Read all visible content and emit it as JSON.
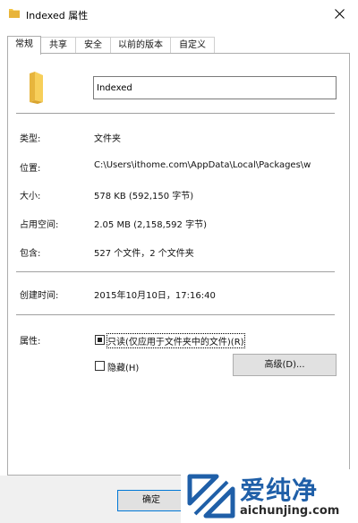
{
  "window": {
    "title": "Indexed 属性",
    "close_icon": "close-icon",
    "folder_icon_color": "#f4c542"
  },
  "tabs": [
    {
      "label": "常规",
      "active": true
    },
    {
      "label": "共享",
      "active": false
    },
    {
      "label": "安全",
      "active": false
    },
    {
      "label": "以前的版本",
      "active": false
    },
    {
      "label": "自定义",
      "active": false
    }
  ],
  "general": {
    "name_value": "Indexed",
    "type": {
      "label": "类型:",
      "value": "文件夹"
    },
    "location": {
      "label": "位置:",
      "value": "C:\\Users\\ithome.com\\AppData\\Local\\Packages\\w"
    },
    "size": {
      "label": "大小:",
      "value": "578 KB (592,150 字节)"
    },
    "size_on_disk": {
      "label": "占用空间:",
      "value": "2.05 MB (2,158,592 字节)"
    },
    "contains": {
      "label": "包含:",
      "value": "527 个文件，2 个文件夹"
    },
    "created": {
      "label": "创建时间:",
      "value": "2015年10月10日，17:16:40"
    },
    "attributes": {
      "label": "属性:",
      "readonly_label": "只读(仅应用于文件夹中的文件)(R)",
      "readonly_checked": true,
      "hidden_label": "隐藏(H)",
      "hidden_checked": false,
      "advanced_button": "高级(D)..."
    }
  },
  "footer": {
    "ok_button": "确定"
  },
  "watermark": {
    "title": "爱纯净",
    "url": "aichunjing.com",
    "brand_color": "#1f5fa8"
  }
}
